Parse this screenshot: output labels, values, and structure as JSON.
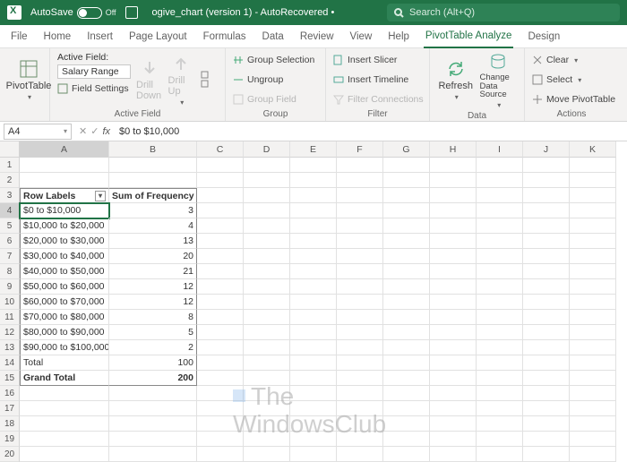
{
  "titlebar": {
    "autosave": "AutoSave",
    "autosave_state": "Off",
    "doc": "ogive_chart (version 1)  -  AutoRecovered  •",
    "search_placeholder": "Search (Alt+Q)"
  },
  "tabs": [
    "File",
    "Home",
    "Insert",
    "Page Layout",
    "Formulas",
    "Data",
    "Review",
    "View",
    "Help",
    "PivotTable Analyze",
    "Design"
  ],
  "active_tab": 9,
  "ribbon": {
    "pivot_btn": "PivotTable",
    "active_field_label": "Active Field:",
    "active_field_value": "Salary Range",
    "field_settings": "Field Settings",
    "drill_down": "Drill Down",
    "drill_up": "Drill Up",
    "group_sel": "Group Selection",
    "ungroup": "Ungroup",
    "group_field": "Group Field",
    "insert_slicer": "Insert Slicer",
    "insert_timeline": "Insert Timeline",
    "filter_conn": "Filter Connections",
    "refresh": "Refresh",
    "change_src": "Change Data Source",
    "clear": "Clear",
    "select": "Select",
    "move": "Move PivotTable",
    "g1": "Active Field",
    "g2": "Group",
    "g3": "Filter",
    "g4": "Data",
    "g5": "Actions"
  },
  "fbar": {
    "name": "A4",
    "value": "$0 to $10,000"
  },
  "cols": [
    "A",
    "B",
    "C",
    "D",
    "E",
    "F",
    "G",
    "H",
    "I",
    "J",
    "K"
  ],
  "pivot": {
    "h1": "Row Labels",
    "h2": "Sum of Frequency",
    "rows": [
      {
        "label": "$0 to $10,000",
        "val": "3"
      },
      {
        "label": "$10,000 to $20,000",
        "val": "4"
      },
      {
        "label": "$20,000 to $30,000",
        "val": "13"
      },
      {
        "label": "$30,000 to $40,000",
        "val": "20"
      },
      {
        "label": "$40,000 to $50,000",
        "val": "21"
      },
      {
        "label": "$50,000 to $60,000",
        "val": "12"
      },
      {
        "label": "$60,000 to $70,000",
        "val": "12"
      },
      {
        "label": "$70,000 to $80,000",
        "val": "8"
      },
      {
        "label": "$80,000 to $90,000",
        "val": "5"
      },
      {
        "label": "$90,000 to $100,000",
        "val": "2"
      },
      {
        "label": "Total",
        "val": "100"
      }
    ],
    "gt_label": "Grand Total",
    "gt_val": "200"
  },
  "watermark": {
    "l1": "The",
    "l2": "WindowsClub"
  }
}
